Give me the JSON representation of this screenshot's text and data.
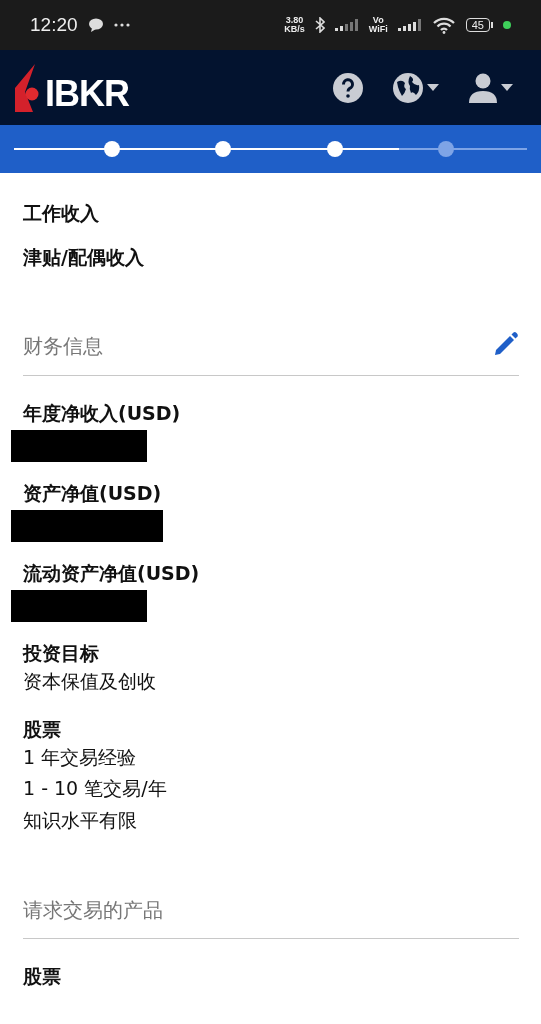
{
  "status_bar": {
    "time": "12:20",
    "net_speed": [
      "3.80",
      "KB/s"
    ],
    "vowifi": [
      "Vo",
      "WiFi"
    ],
    "battery": "45"
  },
  "header": {
    "logo": "IBKR"
  },
  "progress": {
    "level": 0.75,
    "steps": [
      {
        "done": true
      },
      {
        "done": true
      },
      {
        "done": true
      },
      {
        "done": false
      }
    ]
  },
  "sections": [
    {
      "groups": [
        {
          "label": "工作收入"
        },
        {
          "label": "津贴/配偶收入"
        }
      ]
    },
    {
      "title": "财务信息",
      "editable": true,
      "groups": [
        {
          "label": "年度净收入(USD)",
          "redacted": true
        },
        {
          "label": "资产净值(USD)",
          "redacted": true
        },
        {
          "label": "流动资产净值(USD)",
          "redacted": true
        },
        {
          "label": "投资目标",
          "values": [
            "资本保值及创收"
          ]
        },
        {
          "label": "股票",
          "values": [
            "1 年交易经验",
            "1 - 10 笔交易/年",
            "知识水平有限"
          ]
        }
      ]
    },
    {
      "title": "请求交易的产品",
      "editable": false,
      "groups": [
        {
          "label": "股票"
        }
      ]
    }
  ]
}
